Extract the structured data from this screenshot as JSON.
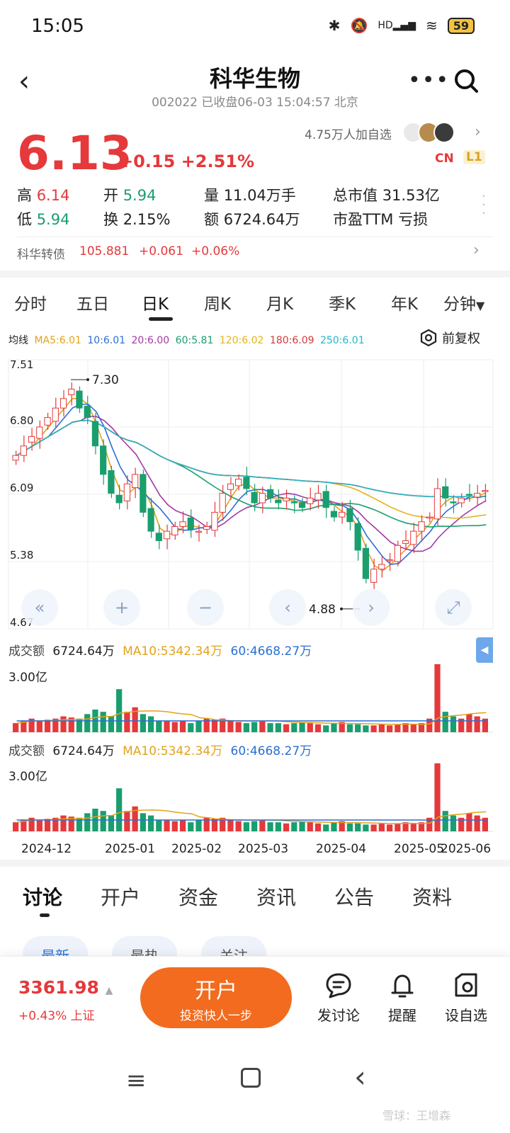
{
  "status_bar": {
    "time": "15:05",
    "battery": "59",
    "net_label": "HD"
  },
  "header": {
    "title": "科华生物",
    "subtitle": "002022 已收盘06-03 15:04:57 北京",
    "more_icon": "more-dots-icon",
    "search_icon": "search-icon"
  },
  "quote": {
    "price": "6.13",
    "change": "+0.15 +2.51%",
    "followers": "4.75万人加自选",
    "badge_cn": "CN",
    "badge_l1": "L1",
    "high_label": "高",
    "high": "6.14",
    "low_label": "低",
    "low": "5.94",
    "open_label": "开",
    "open": "5.94",
    "turnover_label": "换",
    "turnover": "2.15%",
    "volume_label": "量",
    "volume": "11.04万手",
    "amount_label": "额",
    "amount": "6724.64万",
    "mktcap_label": "总市值",
    "mktcap": "31.53亿",
    "pe_label": "市盈TTM",
    "pe": "亏损"
  },
  "bond": {
    "name": "科华转债",
    "price": "105.881",
    "change": "+0.061",
    "pct": "+0.06%"
  },
  "kline_tabs": [
    "分时",
    "五日",
    "日K",
    "周K",
    "月K",
    "季K",
    "年K",
    "分钟"
  ],
  "kline_active": "日K",
  "ma_legend": {
    "prefix": "均线",
    "items": [
      {
        "label": "MA5:6.01",
        "color": "#e3a21a"
      },
      {
        "label": "10:6.01",
        "color": "#2a6fd6"
      },
      {
        "label": "20:6.00",
        "color": "#a33aa3"
      },
      {
        "label": "60:5.81",
        "color": "#1a9e6e"
      },
      {
        "label": "120:6.02",
        "color": "#e3b31a"
      },
      {
        "label": "180:6.09",
        "color": "#d33a3a"
      },
      {
        "label": "250:6.01",
        "color": "#26b5c8"
      }
    ],
    "fuquan": "前复权"
  },
  "chart_data": {
    "type": "candlestick",
    "y_ticks": [
      "7.51",
      "6.80",
      "6.09",
      "5.38",
      "4.67"
    ],
    "ylim": [
      4.67,
      7.51
    ],
    "x_ticks": [
      "2024-12",
      "2025-01",
      "2025-02",
      "2025-03",
      "2025-04",
      "2025-05",
      "2025-06"
    ],
    "annotations": [
      {
        "label": "7.30",
        "value": 7.3
      },
      {
        "label": "4.88",
        "value": 4.88
      }
    ],
    "close_series": [
      6.5,
      6.6,
      6.7,
      6.8,
      6.9,
      7.0,
      7.1,
      7.2,
      7.0,
      6.9,
      6.6,
      6.3,
      6.1,
      6.0,
      6.2,
      6.3,
      5.9,
      5.7,
      5.6,
      5.7,
      5.75,
      5.8,
      5.72,
      5.7,
      5.75,
      5.9,
      6.1,
      6.2,
      6.25,
      6.15,
      6.0,
      6.1,
      6.05,
      6.0,
      6.05,
      6.0,
      5.95,
      6.05,
      6.1,
      5.95,
      5.85,
      5.9,
      5.8,
      5.5,
      5.2,
      5.3,
      5.35,
      5.4,
      5.55,
      5.6,
      5.7,
      5.8,
      5.85,
      6.15,
      6.05,
      6.0,
      6.05,
      6.08,
      6.1,
      6.13
    ],
    "volume_legend": {
      "label": "成交额",
      "amount": "6724.64万",
      "ma10": "MA10:5342.34万",
      "ma60": "60:4668.27万",
      "y_tick": "3.00亿"
    },
    "volume_series": [
      0.4,
      0.5,
      0.6,
      0.5,
      0.55,
      0.6,
      0.7,
      0.65,
      0.6,
      0.8,
      1.0,
      0.9,
      0.7,
      1.9,
      0.9,
      1.1,
      0.8,
      0.7,
      0.5,
      0.5,
      0.45,
      0.5,
      0.4,
      0.5,
      0.6,
      0.55,
      0.6,
      0.5,
      0.45,
      0.4,
      0.45,
      0.5,
      0.4,
      0.4,
      0.35,
      0.4,
      0.45,
      0.4,
      0.35,
      0.3,
      0.4,
      0.45,
      0.35,
      0.35,
      0.3,
      0.3,
      0.35,
      0.3,
      0.35,
      0.4,
      0.35,
      0.4,
      0.6,
      3.0,
      0.9,
      0.7,
      0.6,
      0.8,
      0.7,
      0.6
    ]
  },
  "chart_controls": [
    "«",
    "+",
    "−",
    "‹",
    "›",
    "⤢"
  ],
  "discussion_tabs": [
    "讨论",
    "开户",
    "资金",
    "资讯",
    "公告",
    "资料"
  ],
  "filter_pills": [
    "最新",
    "最热",
    "关注"
  ],
  "bottom": {
    "index_value": "3361.98",
    "index_change": "+0.43% 上证",
    "open_title": "开户",
    "open_sub": "投资快人一步",
    "actions": [
      {
        "label": "发讨论",
        "icon": "chat-icon"
      },
      {
        "label": "提醒",
        "icon": "bell-icon"
      },
      {
        "label": "设自选",
        "icon": "star-settings-icon"
      }
    ]
  },
  "watermark": "雪球：王增森"
}
